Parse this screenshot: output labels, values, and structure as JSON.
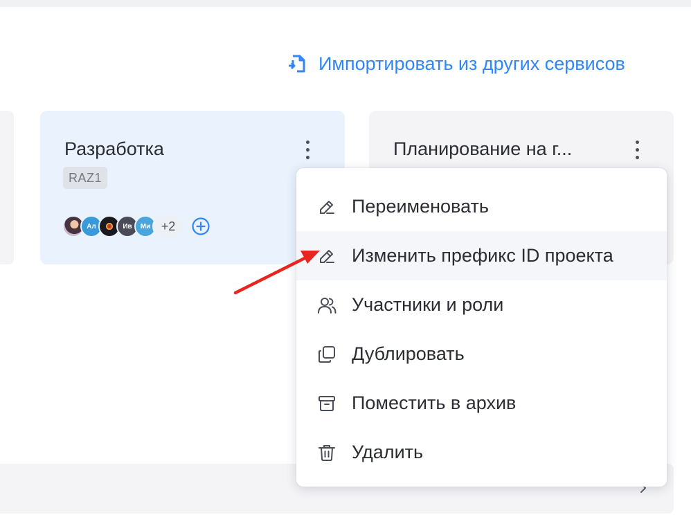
{
  "header": {
    "import_label": "Импортировать из других сервисов",
    "import_icon": "import-file-icon"
  },
  "projects": [
    {
      "title": "Разработка",
      "prefix": "RAZ1",
      "members": [
        {
          "initials": "",
          "kind": "photo"
        },
        {
          "initials": "Ал",
          "kind": "initials"
        },
        {
          "initials": "",
          "kind": "photo"
        },
        {
          "initials": "Ив",
          "kind": "initials"
        },
        {
          "initials": "Ми",
          "kind": "initials"
        }
      ],
      "more_members": "+2"
    },
    {
      "title": "Планирование на г..."
    }
  ],
  "context_menu": {
    "items": [
      {
        "label": "Переименовать",
        "icon": "pencil-icon"
      },
      {
        "label": "Изменить префикс ID проекта",
        "icon": "pencil-icon"
      },
      {
        "label": "Участники и роли",
        "icon": "users-icon"
      },
      {
        "label": "Дублировать",
        "icon": "duplicate-icon"
      },
      {
        "label": "Поместить в архив",
        "icon": "archive-icon"
      },
      {
        "label": "Удалить",
        "icon": "trash-icon"
      }
    ],
    "highlighted_index": 1
  },
  "colors": {
    "accent": "#2f86f6",
    "card_active_bg": "#e9f2fd",
    "card_bg": "#f4f4f6",
    "annotation_arrow": "#e8251f"
  }
}
